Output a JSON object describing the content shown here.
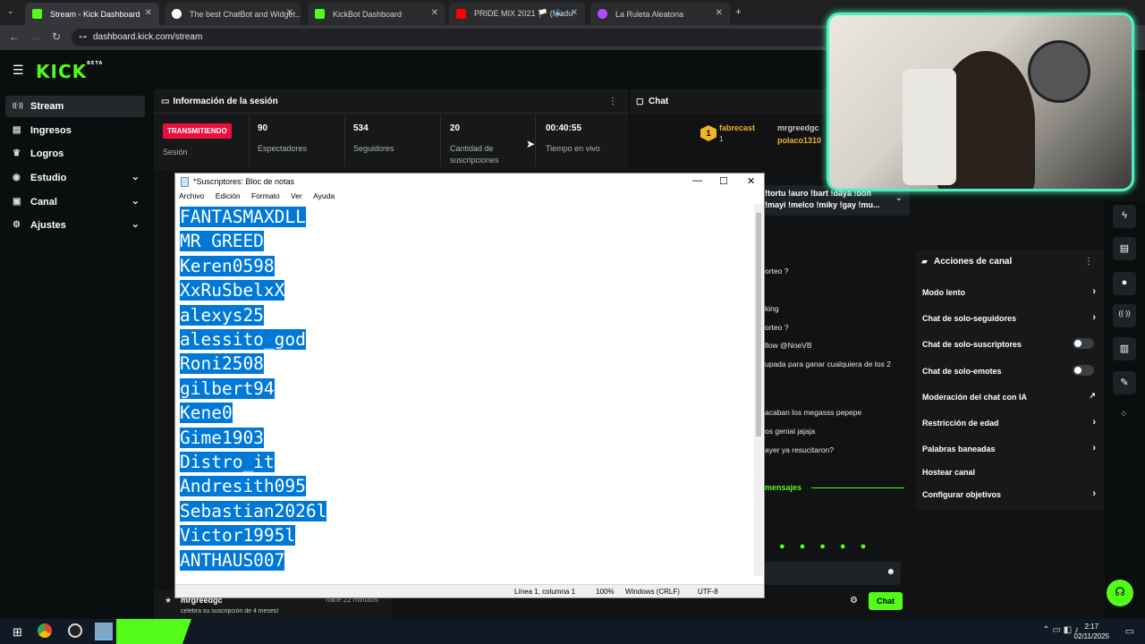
{
  "browser": {
    "tabs": [
      {
        "label": "Stream - Kick Dashboard",
        "active": true,
        "color": "#53fc18"
      },
      {
        "label": "The best ChatBot and Widget...",
        "active": false,
        "color": "#ffffff"
      },
      {
        "label": "KickBot Dashboard",
        "active": false,
        "color": "#53fc18"
      },
      {
        "label": "PRIDE MIX 2021 🏳️ (Madu",
        "active": false,
        "color": "#ff0000"
      },
      {
        "label": "La Ruleta Aleatoria",
        "active": false,
        "color": "#b14cff"
      }
    ],
    "url": "dashboard.kick.com/stream"
  },
  "kick": {
    "logo": "KICK",
    "logo_sup": "BETA",
    "sidebar": [
      {
        "label": "Stream",
        "icon": "broadcast-icon",
        "glyph": "((·))",
        "active": true,
        "chev": false
      },
      {
        "label": "Ingresos",
        "icon": "money-icon",
        "glyph": "▤",
        "active": false,
        "chev": false
      },
      {
        "label": "Logros",
        "icon": "trophy-icon",
        "glyph": "🏆",
        "active": false,
        "chev": false
      },
      {
        "label": "Estudio",
        "icon": "studio-icon",
        "glyph": "◉",
        "active": false,
        "chev": true
      },
      {
        "label": "Canal",
        "icon": "channel-icon",
        "glyph": "▣",
        "active": false,
        "chev": true
      },
      {
        "label": "Ajustes",
        "icon": "settings-icon",
        "glyph": "⚙",
        "active": false,
        "chev": true
      }
    ],
    "session": {
      "title": "Información de la sesión",
      "badge": "TRANSMITIENDO",
      "session_label": "Sesión",
      "stats": [
        {
          "value": "90",
          "label": "Espectadores"
        },
        {
          "value": "534",
          "label": "Seguidores"
        },
        {
          "value": "20",
          "label": "Cantidad de suscripciones"
        },
        {
          "value": "00:40:55",
          "label": "Tiempo en vivo"
        }
      ]
    },
    "chat": {
      "title": "Chat",
      "top_user_rank": "1",
      "top_user": "fabrecast",
      "top_user_sub": "1",
      "second_user": "mrgreedgc",
      "third_user": "polaco1310",
      "pinned": "!tortu !auro !bart !daya !don !mayi !melco !miky !gay !mu...",
      "lines": [
        "orteo ?",
        "king",
        "orteo ?",
        "llow @NoeVB",
        "upada para ganar cualquiera de los 2",
        "acaban los megasss pepepe",
        "os genial jajaja",
        "ayer ya resucitaron?"
      ],
      "new_messages": "mensajes",
      "send_button": "Chat"
    },
    "activity": {
      "user": "mrgreedgc",
      "time": "hace 22 minutos",
      "text": "celebra su suscripción de 4 meses!"
    },
    "actions": {
      "title": "Acciones de canal",
      "items": [
        {
          "label": "Modo lento",
          "control": "chevron"
        },
        {
          "label": "Chat de solo-seguidores",
          "control": "chevron"
        },
        {
          "label": "Chat de solo-suscriptores",
          "control": "toggle"
        },
        {
          "label": "Chat de solo-emotes",
          "control": "toggle"
        },
        {
          "label": "Moderación del chat con IA",
          "control": "external"
        },
        {
          "label": "Restricción de edad",
          "control": "chevron"
        },
        {
          "label": "Palabras baneadas",
          "control": "chevron"
        },
        {
          "label": "Hostear canal",
          "control": "none"
        },
        {
          "label": "Configurar objetivos",
          "control": "chevron"
        }
      ]
    }
  },
  "notepad": {
    "title": "*Suscriptores: Bloc de notas",
    "menu": [
      "Archivo",
      "Edición",
      "Formato",
      "Ver",
      "Ayuda"
    ],
    "lines": [
      "FANTASMAXDLL",
      "MR GREED",
      "Keren0598",
      "XxRuSbelxX",
      "alexys25",
      "alessito_god",
      "Roni2508",
      "gilbert94",
      "Kene0",
      "Gime1903",
      "Distro_it",
      "Andresith095",
      "Sebastian2026l",
      "Victor1995l",
      "ANTHAUS007"
    ],
    "status": {
      "position": "Línea 1, columna 1",
      "zoom": "100%",
      "eol": "Windows (CRLF)",
      "encoding": "UTF-8"
    }
  },
  "taskbar": {
    "time": "2:17",
    "date": "02/11/2025"
  },
  "colors": {
    "kick_green": "#53fc18",
    "live_red": "#e9113c",
    "selection": "#0078d7",
    "cam_border": "#49f3c0"
  }
}
